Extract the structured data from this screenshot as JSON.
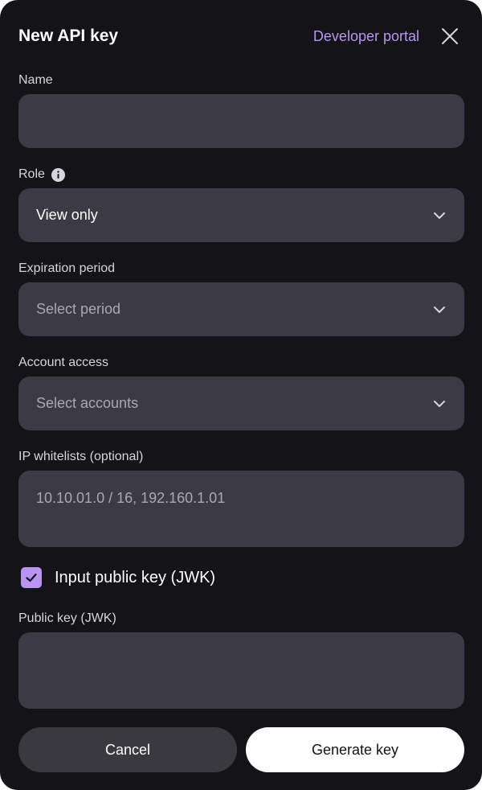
{
  "header": {
    "title": "New API key",
    "portal_link": "Developer portal"
  },
  "fields": {
    "name": {
      "label": "Name",
      "value": ""
    },
    "role": {
      "label": "Role",
      "value": "View only"
    },
    "expiration": {
      "label": "Expiration period",
      "placeholder": "Select period"
    },
    "account_access": {
      "label": "Account access",
      "placeholder": "Select accounts"
    },
    "ip_whitelist": {
      "label": "IP whitelists (optional)",
      "placeholder": "10.10.01.0 / 16, 192.160.1.01"
    },
    "public_key_toggle": {
      "label": "Input public key (JWK)",
      "checked": true
    },
    "public_key": {
      "label": "Public key (JWK)",
      "value": ""
    }
  },
  "actions": {
    "cancel": "Cancel",
    "generate": "Generate key"
  },
  "colors": {
    "background": "#141317",
    "field": "#3c3b45",
    "accent": "#b994f2",
    "primary_button": "#ffffff",
    "secondary_button": "#3a393f"
  }
}
